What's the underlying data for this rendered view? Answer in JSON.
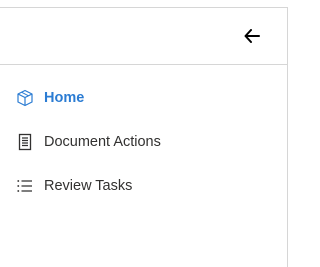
{
  "header": {
    "back_icon": "arrow-left-icon"
  },
  "nav": {
    "items": [
      {
        "label": "Home",
        "icon": "cube-icon",
        "active": true,
        "color": "#2b7cd3"
      },
      {
        "label": "Document Actions",
        "icon": "document-icon",
        "active": false
      },
      {
        "label": "Review Tasks",
        "icon": "list-icon",
        "active": false
      }
    ]
  }
}
